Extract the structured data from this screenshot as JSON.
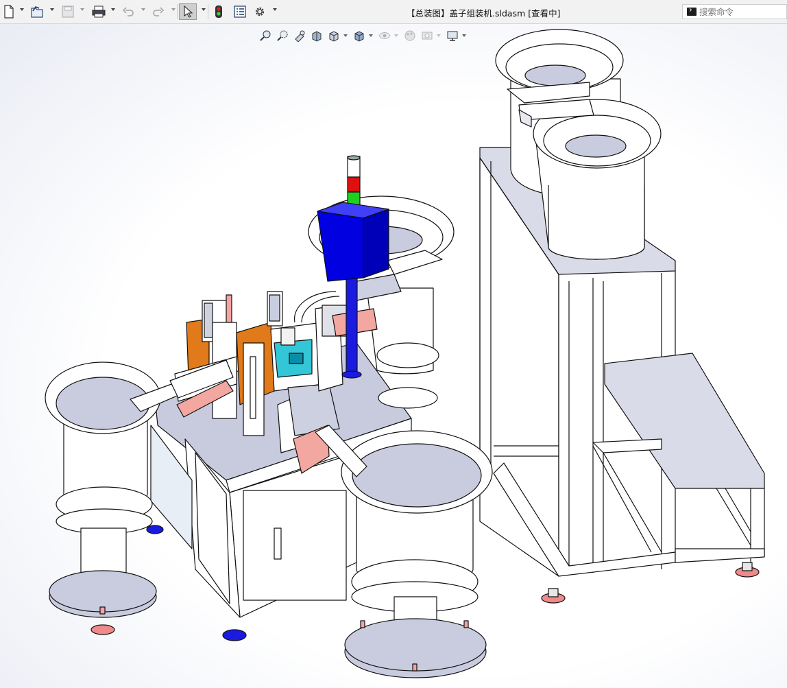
{
  "window": {
    "title": "【总装图】盖子组装机.sldasm [查看中]"
  },
  "toolbar": {
    "items": [
      {
        "name": "new-document",
        "icon": "new-document-icon",
        "has_dropdown": true
      },
      {
        "name": "open",
        "icon": "open-folder-icon",
        "has_dropdown": true
      },
      {
        "name": "save",
        "icon": "save-icon",
        "has_dropdown": true,
        "disabled": true
      },
      {
        "name": "print",
        "icon": "print-icon",
        "has_dropdown": true
      },
      {
        "name": "undo",
        "icon": "undo-icon",
        "has_dropdown": true,
        "disabled": true
      },
      {
        "name": "redo",
        "icon": "redo-icon",
        "has_dropdown": true,
        "disabled": true
      },
      {
        "name": "select",
        "icon": "pointer-icon",
        "has_dropdown": true,
        "active": true
      },
      {
        "name": "rebuild",
        "icon": "traffic-light-icon"
      },
      {
        "name": "file-properties",
        "icon": "properties-icon"
      },
      {
        "name": "options",
        "icon": "gear-icon",
        "has_dropdown": true
      }
    ]
  },
  "search": {
    "placeholder": "搜索命令",
    "icon": "command-prompt-icon"
  },
  "heads_up_toolbar": [
    {
      "name": "zoom-to-fit",
      "icon": "zoom-fit-icon"
    },
    {
      "name": "zoom-to-area",
      "icon": "zoom-area-icon"
    },
    {
      "name": "previous-view",
      "icon": "previous-view-icon"
    },
    {
      "name": "section-view",
      "icon": "section-view-icon"
    },
    {
      "name": "view-orientation",
      "icon": "view-orientation-icon",
      "has_dropdown": true
    },
    {
      "name": "display-style",
      "icon": "display-style-icon",
      "has_dropdown": true
    },
    {
      "name": "hide-show-items",
      "icon": "eye-icon",
      "has_dropdown": true,
      "disabled": true
    },
    {
      "name": "edit-appearance",
      "icon": "appearance-icon",
      "disabled": true
    },
    {
      "name": "apply-scene",
      "icon": "scene-icon",
      "has_dropdown": true,
      "disabled": true
    },
    {
      "name": "view-settings",
      "icon": "monitor-icon",
      "has_dropdown": true
    }
  ],
  "colors": {
    "toolbar_bg": "#f2f2f2",
    "machine_body": "#ffffff",
    "machine_top": "#c8cade",
    "bowl_inner": "#c9cbde",
    "panel_blue": "#0000e0",
    "plate_orange": "#e07a1a",
    "foot_red": "#f08a8a",
    "accent_cyan": "#33c6d6",
    "beacon_red": "#e01010",
    "beacon_green": "#20d020"
  }
}
